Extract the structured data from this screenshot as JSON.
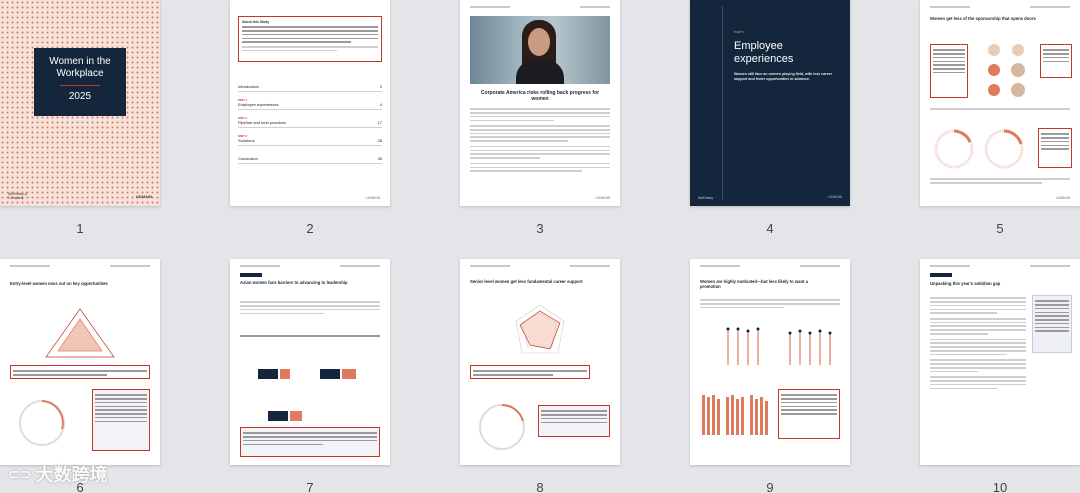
{
  "pages": [
    {
      "num": "1",
      "cover_title": "Women in the Workplace",
      "cover_year": "2025",
      "brand": "McKinsey & Company",
      "partner": "LEAN IN"
    },
    {
      "num": "2",
      "box_title": "About this Study",
      "toc": [
        {
          "part": "",
          "label": "Introduction",
          "page": "3"
        },
        {
          "part": "PART 1",
          "label": "Employee experiences",
          "page": "4"
        },
        {
          "part": "PART 2",
          "label": "Pipeline and best practices",
          "page": "17"
        },
        {
          "part": "PART 3",
          "label": "Solutions",
          "page": "28"
        },
        {
          "part": "",
          "label": "Conclusion",
          "page": "36"
        }
      ]
    },
    {
      "num": "3",
      "heading": "Corporate America risks rolling back progress for women"
    },
    {
      "num": "4",
      "part": "PART 1",
      "heading": "Employee experiences",
      "sub": "Women still face an uneven playing field, with less career support and fewer opportunities to advance."
    },
    {
      "num": "5",
      "heading": "Women get less of the sponsorship that opens doors"
    },
    {
      "num": "6",
      "heading": "Entry-level women miss out on key opportunities"
    },
    {
      "num": "7",
      "heading": "Asian women face barriers to advancing to leadership"
    },
    {
      "num": "8",
      "heading": "Senior-level women get less fundamental career support"
    },
    {
      "num": "9",
      "heading": "Women are highly motivated—but less likely to want a promotion"
    },
    {
      "num": "10",
      "heading": "Unpacking this year's ambition gap"
    }
  ],
  "watermark": "大数跨境"
}
